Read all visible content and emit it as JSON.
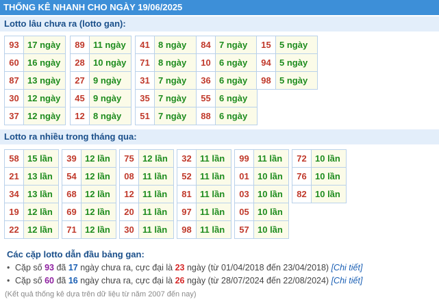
{
  "header": {
    "title": "THỐNG KÊ NHANH CHO NGÀY 19/06/2025"
  },
  "gan": {
    "title": "Lotto lâu chưa ra (lotto gan):",
    "groups": [
      [
        [
          "93",
          "17 ngày"
        ],
        [
          "60",
          "16 ngày"
        ],
        [
          "87",
          "13 ngày"
        ],
        [
          "30",
          "12 ngày"
        ],
        [
          "37",
          "12 ngày"
        ]
      ],
      [
        [
          "89",
          "11 ngày"
        ],
        [
          "28",
          "10 ngày"
        ],
        [
          "27",
          "9 ngày"
        ],
        [
          "45",
          "9 ngày"
        ],
        [
          "12",
          "8 ngày"
        ]
      ],
      [
        [
          "41",
          "8 ngày"
        ],
        [
          "71",
          "8 ngày"
        ],
        [
          "31",
          "7 ngày"
        ],
        [
          "35",
          "7 ngày"
        ],
        [
          "51",
          "7 ngày"
        ]
      ],
      [
        [
          "84",
          "7 ngày"
        ],
        [
          "10",
          "6 ngày"
        ],
        [
          "36",
          "6 ngày"
        ],
        [
          "55",
          "6 ngày"
        ],
        [
          "88",
          "6 ngày"
        ]
      ],
      [
        [
          "15",
          "5 ngày"
        ],
        [
          "94",
          "5 ngày"
        ],
        [
          "98",
          "5 ngày"
        ]
      ]
    ]
  },
  "many": {
    "title": "Lotto ra nhiều trong tháng qua:",
    "groups": [
      [
        [
          "58",
          "15 lần"
        ],
        [
          "21",
          "13 lần"
        ],
        [
          "34",
          "13 lần"
        ],
        [
          "19",
          "12 lần"
        ],
        [
          "22",
          "12 lần"
        ]
      ],
      [
        [
          "39",
          "12 lần"
        ],
        [
          "54",
          "12 lần"
        ],
        [
          "68",
          "12 lần"
        ],
        [
          "69",
          "12 lần"
        ],
        [
          "71",
          "12 lần"
        ]
      ],
      [
        [
          "75",
          "12 lần"
        ],
        [
          "08",
          "11 lần"
        ],
        [
          "12",
          "11 lần"
        ],
        [
          "20",
          "11 lần"
        ],
        [
          "30",
          "11 lần"
        ]
      ],
      [
        [
          "32",
          "11 lần"
        ],
        [
          "52",
          "11 lần"
        ],
        [
          "81",
          "11 lần"
        ],
        [
          "97",
          "11 lần"
        ],
        [
          "98",
          "11 lần"
        ]
      ],
      [
        [
          "99",
          "11 lần"
        ],
        [
          "01",
          "10 lần"
        ],
        [
          "03",
          "10 lần"
        ],
        [
          "05",
          "10 lần"
        ],
        [
          "57",
          "10 lần"
        ]
      ],
      [
        [
          "72",
          "10 lần"
        ],
        [
          "76",
          "10 lần"
        ],
        [
          "82",
          "10 lần"
        ]
      ]
    ]
  },
  "summary": {
    "title": "Các cặp lotto dẫn đầu bảng gan:",
    "bullet": "•",
    "items": [
      {
        "p1": "Cặp số ",
        "pair": "93",
        "p2": " đã ",
        "days": "17",
        "p3": " ngày chưa ra, cực đại là ",
        "max": "23",
        "p4": " ngày (từ 01/04/2018 đến 23/04/2018) ",
        "link": "[Chi tiết]"
      },
      {
        "p1": "Cặp số ",
        "pair": "60",
        "p2": " đã ",
        "days": "16",
        "p3": " ngày chưa ra, cực đại là ",
        "max": "26",
        "p4": " ngày (từ 28/07/2024 đến 22/08/2024) ",
        "link": "[Chi tiết]"
      }
    ]
  },
  "footnote": "(Kết quả thống kê dựa trên dữ liệu từ năm 2007 đến nay)"
}
